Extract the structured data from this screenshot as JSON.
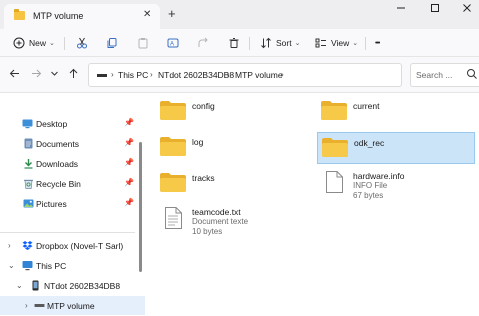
{
  "window": {
    "tab_title": "MTP volume",
    "new_tab_glyph": "+",
    "close_tab_glyph": "✕"
  },
  "toolbar": {
    "new_label": "New",
    "sort_label": "Sort",
    "view_label": "View",
    "more_glyph": "•••"
  },
  "address": {
    "crumbs": [
      "This PC",
      "NTdot 2602B34DB8",
      "MTP volume"
    ],
    "search_placeholder": "Search ..."
  },
  "sidebar": {
    "quick_access": [
      {
        "label": "Desktop",
        "icon": "desktop-icon"
      },
      {
        "label": "Documents",
        "icon": "documents-icon"
      },
      {
        "label": "Downloads",
        "icon": "downloads-icon"
      },
      {
        "label": "Recycle Bin",
        "icon": "recycle-bin-icon"
      },
      {
        "label": "Pictures",
        "icon": "pictures-icon"
      }
    ],
    "tree": [
      {
        "label": "Dropbox (Novel-T Sarl)",
        "icon": "dropbox-icon"
      },
      {
        "label": "This PC",
        "icon": "computer-icon"
      },
      {
        "label": "NTdot 2602B34DB8",
        "icon": "device-icon"
      },
      {
        "label": "MTP volume",
        "icon": "drive-icon"
      }
    ]
  },
  "content": {
    "folders": [
      {
        "name": "config"
      },
      {
        "name": "current"
      },
      {
        "name": "log"
      },
      {
        "name": "odk_rec",
        "selected": true
      },
      {
        "name": "tracks"
      }
    ],
    "files": [
      {
        "name": "hardware.info",
        "type": "INFO File",
        "size": "67 bytes"
      },
      {
        "name": "teamcode.txt",
        "type": "Document texte",
        "size": "10 bytes"
      }
    ]
  },
  "colors": {
    "folder_yellow": "#f6c343",
    "selection_bg": "#cce4f7",
    "sidebar_selected": "#e5eefb"
  }
}
